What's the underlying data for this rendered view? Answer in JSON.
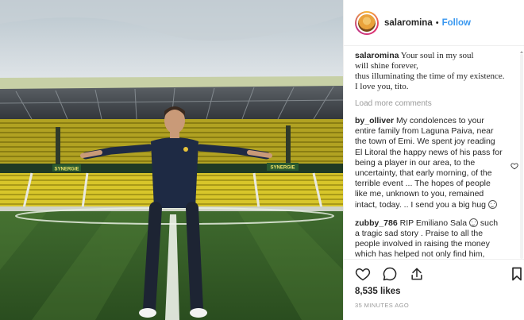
{
  "post": {
    "username": "salaromina",
    "separator": "•",
    "follow_label": "Follow",
    "caption_user": "salaromina",
    "caption_lines": [
      "Your soul in my soul",
      "will shine forever,",
      "thus illuminating the time of my existence.",
      "I love you, tito."
    ],
    "load_more_label": "Load more comments",
    "comments": [
      {
        "user": "by_olliver",
        "text": "My condolences to your entire family from Laguna Paiva, near the town of Emi. We spent joy reading El Litoral the happy news of his pass for being a player in our area, to the uncertainty, that early morning, of the terrible event ... The hopes of people like me, unknown to you, remained intact, today. .. I send you a big hug"
      },
      {
        "user": "zubby_786",
        "text_before_emoji": "RIP Emiliano Sala",
        "text_after_emoji": "such a tragic sad story . Praise to all the people involved in raising the money which has helped not only find him,"
      }
    ],
    "likes": "8,535 likes",
    "time_ago": "35 MINUTES AGO",
    "photo_signs": [
      "SYNERGIE",
      "SYNERGIE"
    ]
  },
  "icons": {
    "like": "heart-icon",
    "comment": "comment-icon",
    "share": "share-icon",
    "save": "bookmark-icon",
    "comment_like": "small-heart-icon"
  },
  "colors": {
    "follow": "#3897f0",
    "muted": "#999999",
    "text": "#262626",
    "border": "#efefef"
  }
}
